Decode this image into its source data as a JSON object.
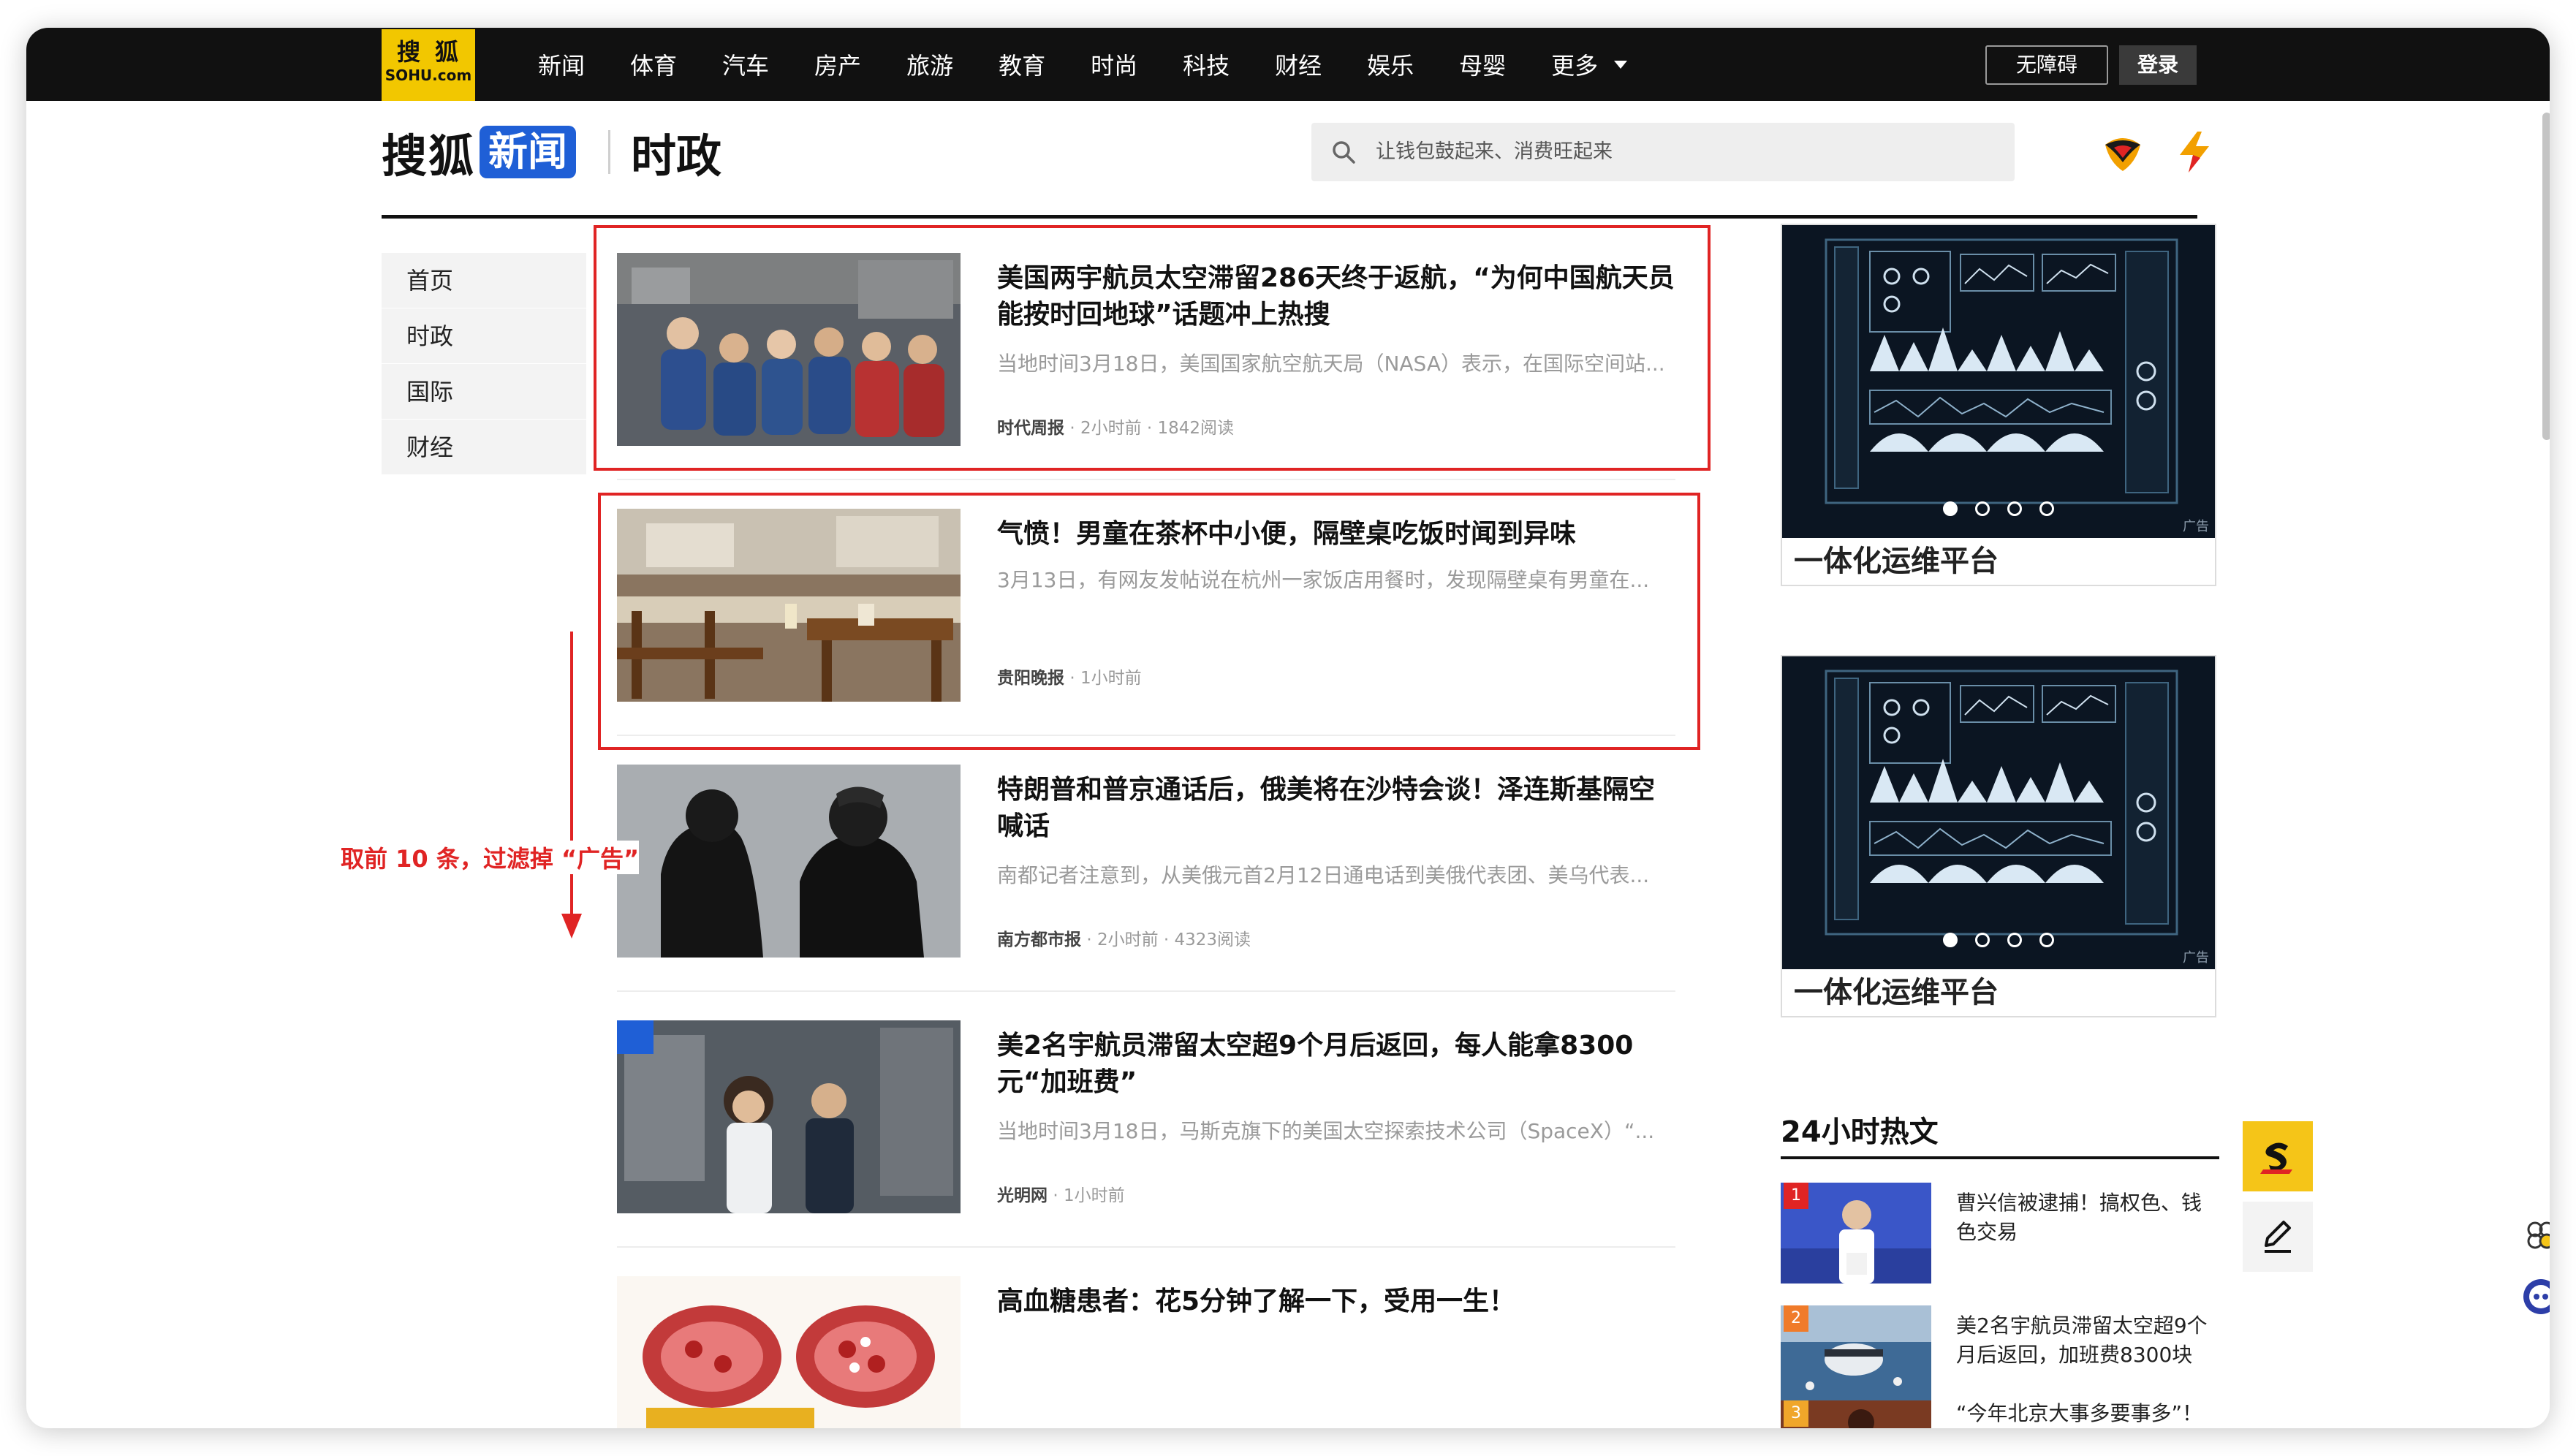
{
  "logo": {
    "line1": "搜狐",
    "line2": "SOHU.com"
  },
  "nav": {
    "items": [
      "新闻",
      "体育",
      "汽车",
      "房产",
      "旅游",
      "教育",
      "时尚",
      "科技",
      "财经",
      "娱乐",
      "母婴"
    ],
    "more_label": "更多",
    "accessibility_label": "无障碍",
    "login_label": "登录"
  },
  "header": {
    "brand": "搜狐",
    "brand_news": "新闻",
    "section": "时政",
    "search_placeholder": "让钱包鼓起来、消费旺起来"
  },
  "left_menu": [
    "首页",
    "时政",
    "国际",
    "财经"
  ],
  "feed": [
    {
      "title": "美国两宇航员太空滞留286天终于返航，“为何中国航天员能按时回地球”话题冲上热搜",
      "summary": "当地时间3月18日，美国国家航空航天局（NASA）表示，在国际空间站...",
      "source": "时代周报",
      "time": "2小时前",
      "reads": "1842阅读"
    },
    {
      "title": "气愤！男童在茶杯中小便，隔壁桌吃饭时闻到异味",
      "summary": "3月13日，有网友发帖说在杭州一家饭店用餐时，发现隔壁桌有男童在...",
      "source": "贵阳晚报",
      "time": "1小时前",
      "reads": ""
    },
    {
      "title": "特朗普和普京通话后，俄美将在沙特会谈！泽连斯基隔空喊话",
      "summary": "南都记者注意到，从美俄元首2月12日通电话到美俄代表团、美乌代表...",
      "source": "南方都市报",
      "time": "2小时前",
      "reads": "4323阅读"
    },
    {
      "title": "美2名宇航员滞留太空超9个月后返回，每人能拿8300元“加班费”",
      "summary": "当地时间3月18日，马斯克旗下的美国太空探索技术公司（SpaceX）“...",
      "source": "光明网",
      "time": "1小时前",
      "reads": ""
    },
    {
      "title": "高血糖患者：花5分钟了解一下，受用一生！",
      "summary": "",
      "source": "",
      "time": "",
      "reads": ""
    }
  ],
  "annotation": {
    "text": "取前 10 条，过滤掉 “广告”",
    "color": "#e02424"
  },
  "ads": [
    {
      "caption": "一体化运维平台",
      "tag": "广告"
    },
    {
      "caption": "一体化运维平台",
      "tag": "广告"
    }
  ],
  "hot": {
    "title": "24小时热文",
    "items": [
      {
        "rank": "1",
        "text": "曹兴信被逮捕！搞权色、钱色交易",
        "rank_color": "#e02424"
      },
      {
        "rank": "2",
        "text": "美2名宇航员滞留太空超9个月后返回，加班费8300块",
        "rank_color": "#f07b2a"
      },
      {
        "rank": "3",
        "text": "“今年北京大事多要事多”！",
        "rank_color": "#f0a62a"
      }
    ]
  },
  "colors": {
    "brand_blue": "#1f5fd6",
    "logo_yellow": "#f2c700",
    "highlight_red": "#e02424",
    "topbar": "#111111"
  },
  "icons": [
    "search-icon",
    "sohu-emblem-icon",
    "lightning-icon",
    "sohu-s-icon",
    "edit-icon",
    "robot-icon",
    "chat-icon"
  ]
}
